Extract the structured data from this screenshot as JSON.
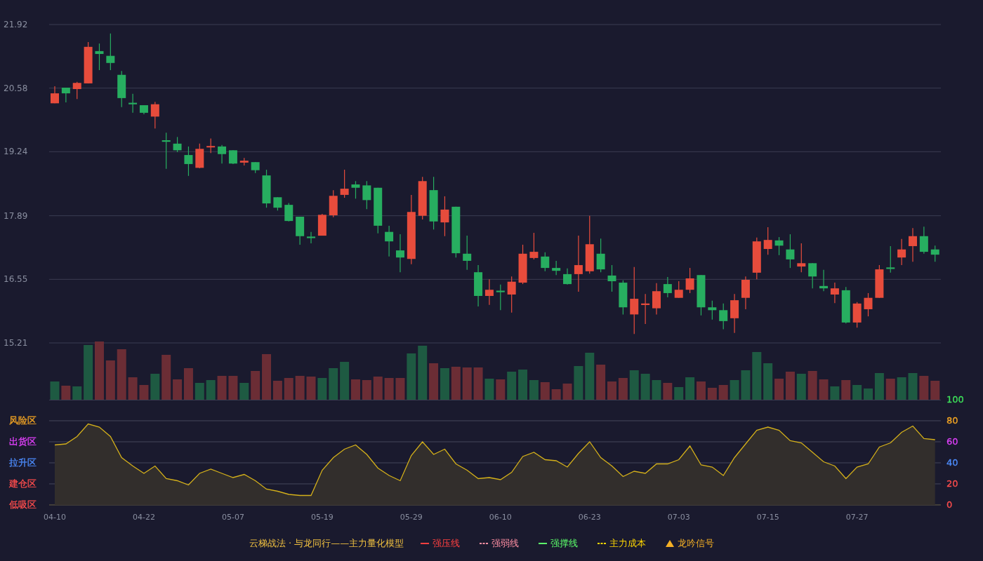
{
  "price_chart": {
    "chart_data": {
      "type": "candlestick",
      "grid": true,
      "ylim": [
        15.21,
        21.92
      ],
      "yticks": [
        15.21,
        16.55,
        17.89,
        19.24,
        20.58,
        21.92
      ],
      "categories": [
        null,
        null,
        null,
        null,
        null,
        null,
        null,
        null,
        null,
        null,
        null,
        null,
        null,
        null,
        null,
        null,
        null,
        null,
        null,
        null,
        null,
        null,
        null,
        null,
        null,
        null,
        null,
        null,
        null,
        null,
        null,
        null,
        null,
        null,
        null,
        null,
        null,
        null,
        null,
        null,
        null,
        null,
        null,
        null,
        null,
        null,
        null,
        null,
        null,
        null,
        null,
        null,
        null,
        null,
        null,
        null,
        null,
        null,
        null,
        null,
        null,
        null,
        null,
        null,
        null,
        null,
        null,
        null,
        null,
        null,
        null,
        null,
        null,
        null,
        null,
        null,
        null,
        null,
        null,
        null
      ],
      "ohlc": [
        [
          20.26,
          20.62,
          20.26,
          20.47
        ],
        [
          20.59,
          20.59,
          20.28,
          20.47
        ],
        [
          20.56,
          20.71,
          20.35,
          20.69
        ],
        [
          20.68,
          21.55,
          20.68,
          21.45
        ],
        [
          21.36,
          21.52,
          20.96,
          21.3
        ],
        [
          21.26,
          21.73,
          20.96,
          21.11
        ],
        [
          20.86,
          20.94,
          20.18,
          20.37
        ],
        [
          20.26,
          20.46,
          20.06,
          20.25
        ],
        [
          20.22,
          20.22,
          20.03,
          20.06
        ],
        [
          19.98,
          20.29,
          19.73,
          20.24
        ],
        [
          19.47,
          19.64,
          18.88,
          19.46
        ],
        [
          19.41,
          19.55,
          19.23,
          19.27
        ],
        [
          19.17,
          19.35,
          18.73,
          18.98
        ],
        [
          18.9,
          19.41,
          18.89,
          19.3
        ],
        [
          19.33,
          19.52,
          19.21,
          19.36
        ],
        [
          19.35,
          19.38,
          18.99,
          19.19
        ],
        [
          19.27,
          19.27,
          18.98,
          18.99
        ],
        [
          19.01,
          19.11,
          18.95,
          19.05
        ],
        [
          19.02,
          19.02,
          18.79,
          18.85
        ],
        [
          18.74,
          18.86,
          18.06,
          18.15
        ],
        [
          18.28,
          18.28,
          18.0,
          18.06
        ],
        [
          18.12,
          18.16,
          17.77,
          17.78
        ],
        [
          17.87,
          17.87,
          17.28,
          17.46
        ],
        [
          17.44,
          17.55,
          17.31,
          17.43
        ],
        [
          17.47,
          17.93,
          17.47,
          17.91
        ],
        [
          17.9,
          18.43,
          17.86,
          18.31
        ],
        [
          18.33,
          18.86,
          18.27,
          18.46
        ],
        [
          18.55,
          18.62,
          18.25,
          18.48
        ],
        [
          18.53,
          18.62,
          18.03,
          18.22
        ],
        [
          18.48,
          18.48,
          17.52,
          17.68
        ],
        [
          17.55,
          17.68,
          17.03,
          17.35
        ],
        [
          17.16,
          17.5,
          16.7,
          17.01
        ],
        [
          16.98,
          18.33,
          16.87,
          17.97
        ],
        [
          17.89,
          18.71,
          17.81,
          18.62
        ],
        [
          18.43,
          18.71,
          17.6,
          17.77
        ],
        [
          17.75,
          18.3,
          17.46,
          18.02
        ],
        [
          18.08,
          18.08,
          17.01,
          17.1
        ],
        [
          17.09,
          17.47,
          16.75,
          16.94
        ],
        [
          16.7,
          16.85,
          15.98,
          16.2
        ],
        [
          16.2,
          16.55,
          16.01,
          16.33
        ],
        [
          16.3,
          16.44,
          15.9,
          16.29
        ],
        [
          16.23,
          16.61,
          15.85,
          16.5
        ],
        [
          16.48,
          17.28,
          16.45,
          17.09
        ],
        [
          17.0,
          17.53,
          16.97,
          17.13
        ],
        [
          17.03,
          17.12,
          16.72,
          16.79
        ],
        [
          16.79,
          16.94,
          16.64,
          16.73
        ],
        [
          16.66,
          16.78,
          16.44,
          16.45
        ],
        [
          16.66,
          17.47,
          16.29,
          16.85
        ],
        [
          16.72,
          17.89,
          16.67,
          17.29
        ],
        [
          17.09,
          17.41,
          16.7,
          16.76
        ],
        [
          16.63,
          16.85,
          16.29,
          16.51
        ],
        [
          16.48,
          16.53,
          15.81,
          15.96
        ],
        [
          15.81,
          16.81,
          15.4,
          16.14
        ],
        [
          16.02,
          16.24,
          15.61,
          16.03
        ],
        [
          15.94,
          16.47,
          15.81,
          16.3
        ],
        [
          16.45,
          16.6,
          16.17,
          16.26
        ],
        [
          16.16,
          16.51,
          16.16,
          16.33
        ],
        [
          16.33,
          16.79,
          16.26,
          16.57
        ],
        [
          16.64,
          16.64,
          15.79,
          15.96
        ],
        [
          15.96,
          16.1,
          15.7,
          15.9
        ],
        [
          15.9,
          16.04,
          15.5,
          15.67
        ],
        [
          15.73,
          16.24,
          15.42,
          16.11
        ],
        [
          16.16,
          16.61,
          15.92,
          16.54
        ],
        [
          16.69,
          17.43,
          16.55,
          17.35
        ],
        [
          17.19,
          17.65,
          17.07,
          17.38
        ],
        [
          17.37,
          17.44,
          17.06,
          17.26
        ],
        [
          17.18,
          17.5,
          16.79,
          16.97
        ],
        [
          16.82,
          17.31,
          16.7,
          16.89
        ],
        [
          16.89,
          16.89,
          16.36,
          16.61
        ],
        [
          16.41,
          16.75,
          16.3,
          16.36
        ],
        [
          16.23,
          16.48,
          16.05,
          16.36
        ],
        [
          16.32,
          16.39,
          15.62,
          15.64
        ],
        [
          15.64,
          16.07,
          15.53,
          16.04
        ],
        [
          15.92,
          16.26,
          15.77,
          16.16
        ],
        [
          16.16,
          16.85,
          16.16,
          16.76
        ],
        [
          16.79,
          17.25,
          16.69,
          16.78
        ],
        [
          17.01,
          17.4,
          16.85,
          17.18
        ],
        [
          17.25,
          17.63,
          16.92,
          17.46
        ],
        [
          17.46,
          17.66,
          17.09,
          17.13
        ],
        [
          17.18,
          17.26,
          16.92,
          17.07
        ]
      ]
    }
  },
  "oscillator": {
    "zones": [
      {
        "label": "风险区",
        "color": "#f5a623"
      },
      {
        "label": "出货区",
        "color": "#e040fb"
      },
      {
        "label": "拉升区",
        "color": "#4d8dff"
      },
      {
        "label": "建仓区",
        "color": "#ff4d4d"
      },
      {
        "label": "低吸区",
        "color": "#ff4d4d"
      }
    ],
    "axis_ticks": [
      {
        "label": "100",
        "color": "#3ee35a"
      },
      {
        "label": "80",
        "color": "#f5a623"
      },
      {
        "label": "60",
        "color": "#e040fb"
      },
      {
        "label": "40",
        "color": "#4d8dff"
      },
      {
        "label": "20",
        "color": "#ff4d4d"
      },
      {
        "label": "0",
        "color": "#ff4d4d"
      }
    ],
    "chart_data": {
      "type": "area",
      "grid": true,
      "ylim": [
        0,
        100
      ],
      "yticks": [
        100,
        80,
        60,
        40,
        20,
        0
      ],
      "categories": [
        "04-10",
        null,
        null,
        null,
        null,
        null,
        null,
        null,
        "04-22",
        null,
        null,
        null,
        null,
        null,
        null,
        null,
        "05-07",
        null,
        null,
        null,
        null,
        null,
        null,
        null,
        "05-19",
        null,
        null,
        null,
        null,
        null,
        null,
        null,
        "05-29",
        null,
        null,
        null,
        null,
        null,
        null,
        null,
        "06-10",
        null,
        null,
        null,
        null,
        null,
        null,
        null,
        "06-23",
        null,
        null,
        null,
        null,
        null,
        null,
        null,
        "07-03",
        null,
        null,
        null,
        null,
        null,
        null,
        null,
        "07-15",
        null,
        null,
        null,
        null,
        null,
        null,
        null,
        "07-27",
        null,
        null,
        null,
        null,
        null,
        null,
        null
      ],
      "values": [
        57,
        58,
        65,
        77,
        74,
        65,
        45,
        37,
        30,
        37,
        25,
        23,
        19,
        30,
        34,
        30,
        26,
        29,
        23,
        15,
        13,
        10,
        9,
        9,
        33,
        45,
        53,
        57,
        48,
        35,
        28,
        23,
        47,
        60,
        48,
        53,
        39,
        33,
        25,
        26,
        24,
        31,
        46,
        50,
        43,
        42,
        36,
        49,
        60,
        45,
        37,
        27,
        32,
        30,
        39,
        39,
        43,
        56,
        38,
        36,
        28,
        45,
        58,
        71,
        74,
        71,
        61,
        59,
        50,
        41,
        37,
        25,
        36,
        39,
        55,
        59,
        69,
        75,
        63,
        62
      ]
    }
  },
  "legend": {
    "title": "云梯战法 · 与龙同行——主力量化模型",
    "items": [
      {
        "label": "强压线",
        "kind": "solid",
        "color": "#ff4040"
      },
      {
        "label": "强弱线",
        "kind": "dashed",
        "color": "#ff8fa3"
      },
      {
        "label": "强撑线",
        "kind": "solid",
        "color": "#5cff6b"
      },
      {
        "label": "主力成本",
        "kind": "dashed",
        "color": "#ffd700"
      },
      {
        "label": "龙吟信号",
        "kind": "triangle",
        "color": "#f5b025"
      }
    ]
  }
}
